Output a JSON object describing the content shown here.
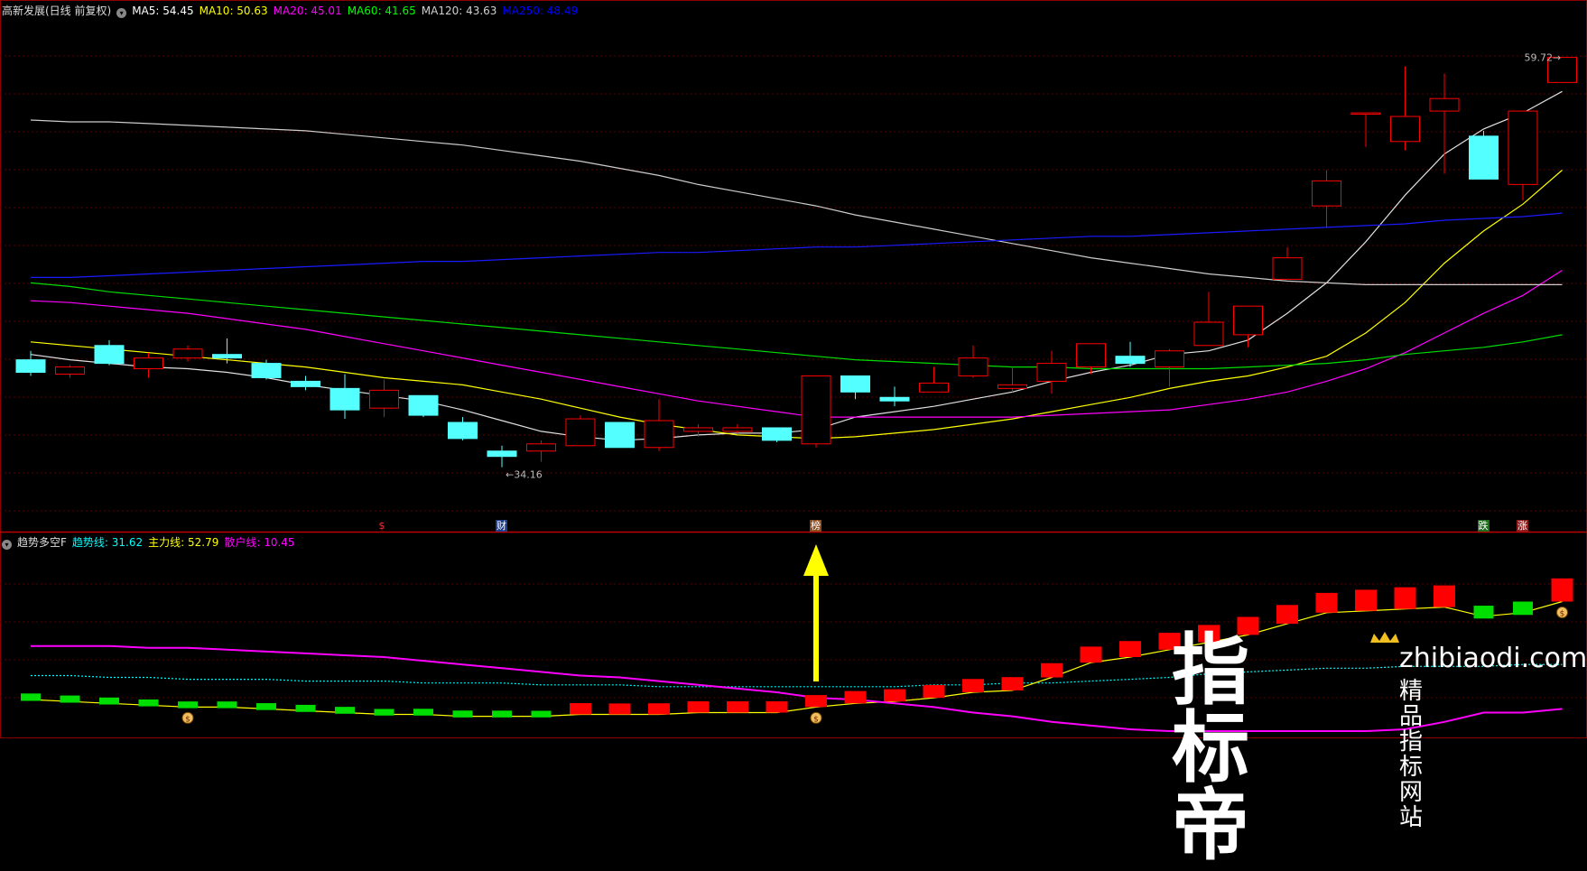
{
  "main_header": {
    "title": "高新发展(日线 前复权)",
    "indicators": [
      {
        "label": "MA5: 54.45",
        "color": "#ffffff"
      },
      {
        "label": "MA10: 50.63",
        "color": "#ffff00"
      },
      {
        "label": "MA20: 45.01",
        "color": "#ff00ff"
      },
      {
        "label": "MA60: 41.65",
        "color": "#00ff00"
      },
      {
        "label": "MA120: 43.63",
        "color": "#d0d0d0"
      },
      {
        "label": "MA250: 48.49",
        "color": "#0000ff"
      }
    ]
  },
  "sub_header": {
    "title": "趋势多空F",
    "indicators": [
      {
        "label": "趋势线: 31.62",
        "color": "#00ffff"
      },
      {
        "label": "主力线: 52.79",
        "color": "#ffff00"
      },
      {
        "label": "散户线: 10.45",
        "color": "#ff00ff"
      }
    ]
  },
  "annotations": {
    "high_label": "59.72",
    "low_label": "34.16",
    "events": [
      {
        "text": "$",
        "index": 9,
        "color": "#ff3333",
        "bg": "transparent"
      },
      {
        "text": "财",
        "index": 12,
        "color": "#ffffff",
        "bg": "#1c3c8c"
      },
      {
        "text": "榜",
        "index": 20,
        "color": "#ffffff",
        "bg": "#8c4a1c"
      },
      {
        "text": "跌",
        "index": 37,
        "color": "#ffffff",
        "bg": "#1c6c1c"
      },
      {
        "text": "涨",
        "index": 38,
        "color": "#ffffff",
        "bg": "#8c1c1c"
      }
    ]
  },
  "watermark": {
    "brand": "指标帝",
    "url": "zhibiaodi.com",
    "tagline": "精品指标网站"
  },
  "chart_data": [
    {
      "type": "candlestick",
      "title": "高新发展(日线 前复权)",
      "ylim": [
        33.5,
        62
      ],
      "up_color": "#ff0000",
      "down_color": "#54ffff",
      "candles": [
        {
          "o": 42.8,
          "h": 43.3,
          "l": 41.9,
          "c": 42.1
        },
        {
          "o": 42.0,
          "h": 42.5,
          "l": 41.8,
          "c": 42.4
        },
        {
          "o": 43.6,
          "h": 43.9,
          "l": 42.5,
          "c": 42.6
        },
        {
          "o": 42.3,
          "h": 43.2,
          "l": 41.8,
          "c": 42.9
        },
        {
          "o": 42.9,
          "h": 43.6,
          "l": 42.7,
          "c": 43.4
        },
        {
          "o": 43.1,
          "h": 44.0,
          "l": 42.6,
          "c": 42.9
        },
        {
          "o": 42.6,
          "h": 42.8,
          "l": 41.7,
          "c": 41.8
        },
        {
          "o": 41.6,
          "h": 41.9,
          "l": 41.1,
          "c": 41.3
        },
        {
          "o": 41.2,
          "h": 42.0,
          "l": 39.5,
          "c": 40.0
        },
        {
          "o": 40.1,
          "h": 41.7,
          "l": 39.6,
          "c": 41.1
        },
        {
          "o": 40.8,
          "h": 40.8,
          "l": 39.6,
          "c": 39.7
        },
        {
          "o": 39.3,
          "h": 39.6,
          "l": 38.3,
          "c": 38.4
        },
        {
          "o": 37.7,
          "h": 38.0,
          "l": 36.8,
          "c": 37.4
        },
        {
          "o": 37.7,
          "h": 38.3,
          "l": 37.1,
          "c": 38.1
        },
        {
          "o": 38.0,
          "h": 39.7,
          "l": 38.0,
          "c": 39.5
        },
        {
          "o": 39.3,
          "h": 39.3,
          "l": 37.9,
          "c": 37.9
        },
        {
          "o": 37.9,
          "h": 40.6,
          "l": 37.7,
          "c": 39.4
        },
        {
          "o": 38.8,
          "h": 39.2,
          "l": 38.5,
          "c": 39.0
        },
        {
          "o": 38.8,
          "h": 39.2,
          "l": 38.7,
          "c": 39.0
        },
        {
          "o": 39.0,
          "h": 39.0,
          "l": 38.2,
          "c": 38.3
        },
        {
          "o": 38.1,
          "h": 41.9,
          "l": 37.9,
          "c": 41.9
        },
        {
          "o": 41.9,
          "h": 41.9,
          "l": 40.6,
          "c": 41.0
        },
        {
          "o": 40.7,
          "h": 41.3,
          "l": 40.2,
          "c": 40.5
        },
        {
          "o": 41.0,
          "h": 42.4,
          "l": 41.0,
          "c": 41.5
        },
        {
          "o": 41.9,
          "h": 43.6,
          "l": 41.8,
          "c": 42.9
        },
        {
          "o": 41.2,
          "h": 42.4,
          "l": 41.0,
          "c": 41.4
        },
        {
          "o": 41.6,
          "h": 43.3,
          "l": 40.9,
          "c": 42.6
        },
        {
          "o": 42.4,
          "h": 43.5,
          "l": 42.0,
          "c": 43.7
        },
        {
          "o": 43.0,
          "h": 43.8,
          "l": 42.4,
          "c": 42.6
        },
        {
          "o": 42.4,
          "h": 43.4,
          "l": 41.3,
          "c": 43.3
        },
        {
          "o": 43.6,
          "h": 46.6,
          "l": 43.6,
          "c": 44.9
        },
        {
          "o": 44.2,
          "h": 45.6,
          "l": 43.5,
          "c": 45.8
        },
        {
          "o": 47.3,
          "h": 49.1,
          "l": 47.3,
          "c": 48.5
        },
        {
          "o": 51.4,
          "h": 53.4,
          "l": 50.2,
          "c": 52.8
        },
        {
          "o": 56.6,
          "h": 56.6,
          "l": 54.7,
          "c": 56.6
        },
        {
          "o": 55.0,
          "h": 59.2,
          "l": 54.5,
          "c": 56.4
        },
        {
          "o": 56.7,
          "h": 58.8,
          "l": 53.2,
          "c": 57.4
        },
        {
          "o": 55.3,
          "h": 55.6,
          "l": 52.9,
          "c": 52.9
        },
        {
          "o": 52.6,
          "h": 56.7,
          "l": 51.7,
          "c": 56.7
        },
        {
          "o": 58.3,
          "h": 59.7,
          "l": 58.3,
          "c": 59.7
        }
      ],
      "series": [
        {
          "name": "MA5",
          "color": "#e0e0e0",
          "values": [
            43.1,
            42.8,
            42.6,
            42.4,
            42.3,
            42.1,
            41.8,
            41.4,
            41.1,
            40.8,
            40.5,
            40.0,
            39.4,
            38.8,
            38.5,
            38.3,
            38.4,
            38.6,
            38.7,
            38.7,
            38.9,
            39.6,
            39.9,
            40.2,
            40.6,
            41.0,
            41.6,
            42.1,
            42.5,
            43.1,
            43.3,
            43.9,
            45.4,
            47.1,
            49.4,
            52.0,
            54.3,
            55.7,
            56.6,
            57.8
          ]
        },
        {
          "name": "MA10",
          "color": "#ffff00",
          "values": [
            43.8,
            43.6,
            43.4,
            43.2,
            43.0,
            42.8,
            42.6,
            42.4,
            42.1,
            41.8,
            41.6,
            41.4,
            41.0,
            40.6,
            40.1,
            39.6,
            39.2,
            38.9,
            38.6,
            38.5,
            38.4,
            38.5,
            38.7,
            38.9,
            39.2,
            39.5,
            39.9,
            40.3,
            40.7,
            41.2,
            41.6,
            41.9,
            42.4,
            43.0,
            44.3,
            46.0,
            48.2,
            50.0,
            51.5,
            53.4
          ]
        },
        {
          "name": "MA20",
          "color": "#ff00ff",
          "values": [
            46.1,
            46.0,
            45.8,
            45.6,
            45.4,
            45.1,
            44.8,
            44.5,
            44.1,
            43.7,
            43.3,
            42.9,
            42.5,
            42.1,
            41.7,
            41.3,
            40.9,
            40.5,
            40.2,
            39.9,
            39.6,
            39.6,
            39.6,
            39.6,
            39.6,
            39.6,
            39.7,
            39.8,
            39.9,
            40.0,
            40.3,
            40.6,
            41.0,
            41.6,
            42.3,
            43.2,
            44.3,
            45.4,
            46.4,
            47.8
          ]
        },
        {
          "name": "MA60",
          "color": "#00dd00",
          "values": [
            47.1,
            46.9,
            46.6,
            46.4,
            46.2,
            46.0,
            45.8,
            45.6,
            45.4,
            45.2,
            45.0,
            44.8,
            44.6,
            44.4,
            44.2,
            44.0,
            43.8,
            43.6,
            43.4,
            43.2,
            43.0,
            42.8,
            42.7,
            42.6,
            42.5,
            42.4,
            42.4,
            42.3,
            42.3,
            42.3,
            42.3,
            42.4,
            42.5,
            42.6,
            42.8,
            43.1,
            43.3,
            43.5,
            43.8,
            44.2
          ]
        },
        {
          "name": "MA120",
          "color": "#cccccc",
          "values": [
            56.2,
            56.1,
            56.1,
            56.0,
            55.9,
            55.8,
            55.7,
            55.6,
            55.4,
            55.2,
            55.0,
            54.8,
            54.5,
            54.2,
            53.9,
            53.5,
            53.1,
            52.6,
            52.2,
            51.8,
            51.4,
            50.9,
            50.5,
            50.1,
            49.7,
            49.3,
            48.9,
            48.5,
            48.2,
            47.9,
            47.6,
            47.4,
            47.2,
            47.1,
            47.0,
            47.0,
            47.0,
            47.0,
            47.0,
            47.0
          ]
        },
        {
          "name": "MA250",
          "color": "#1a1aff",
          "values": [
            47.4,
            47.4,
            47.5,
            47.6,
            47.7,
            47.8,
            47.9,
            48.0,
            48.1,
            48.2,
            48.3,
            48.3,
            48.4,
            48.5,
            48.6,
            48.7,
            48.8,
            48.8,
            48.9,
            49.0,
            49.1,
            49.1,
            49.2,
            49.3,
            49.4,
            49.5,
            49.6,
            49.7,
            49.7,
            49.8,
            49.9,
            50.0,
            50.1,
            50.2,
            50.3,
            50.4,
            50.6,
            50.7,
            50.8,
            51.0
          ]
        }
      ]
    },
    {
      "type": "bar",
      "title": "趋势多空F",
      "ylim": [
        0,
        100
      ],
      "bars": [
        {
          "value": -9,
          "dir": "down"
        },
        {
          "value": -7,
          "dir": "down"
        },
        {
          "value": -5,
          "dir": "down"
        },
        {
          "value": -4,
          "dir": "down"
        },
        {
          "value": -2,
          "dir": "down"
        },
        {
          "value": -2,
          "dir": "down"
        },
        {
          "value": -4,
          "dir": "down"
        },
        {
          "value": -6,
          "dir": "down"
        },
        {
          "value": -4,
          "dir": "down"
        },
        {
          "value": -1,
          "dir": "down"
        },
        {
          "value": -3,
          "dir": "down"
        },
        {
          "value": -4,
          "dir": "down"
        },
        {
          "value": -3,
          "dir": "down"
        },
        {
          "value": -1,
          "dir": "down"
        },
        {
          "value": 3,
          "dir": "up"
        },
        {
          "value": 1,
          "dir": "up"
        },
        {
          "value": 2,
          "dir": "up"
        },
        {
          "value": 3,
          "dir": "up"
        },
        {
          "value": 3,
          "dir": "up"
        },
        {
          "value": 3,
          "dir": "up"
        },
        {
          "value": 7,
          "dir": "up"
        },
        {
          "value": 9,
          "dir": "up"
        },
        {
          "value": 9,
          "dir": "up"
        },
        {
          "value": 12,
          "dir": "up"
        },
        {
          "value": 15,
          "dir": "up"
        },
        {
          "value": 15,
          "dir": "up"
        },
        {
          "value": 21,
          "dir": "up"
        },
        {
          "value": 32,
          "dir": "up"
        },
        {
          "value": 32,
          "dir": "up"
        },
        {
          "value": 37,
          "dir": "up"
        },
        {
          "value": 40,
          "dir": "up"
        },
        {
          "value": 44,
          "dir": "up"
        },
        {
          "value": 49,
          "dir": "up"
        },
        {
          "value": 55,
          "dir": "up"
        },
        {
          "value": 63,
          "dir": "up"
        },
        {
          "value": 67,
          "dir": "up"
        },
        {
          "value": 67,
          "dir": "up"
        },
        {
          "value": -65,
          "dir": "down"
        },
        {
          "value": -70,
          "dir": "down"
        },
        {
          "value": 76,
          "dir": "up"
        }
      ],
      "series": [
        {
          "name": "趋势线",
          "color": "#00ffff",
          "values": [
            30,
            30,
            29,
            29,
            28,
            28,
            28,
            27,
            27,
            27,
            26,
            26,
            26,
            25,
            25,
            25,
            24,
            24,
            24,
            24,
            24,
            24,
            24,
            25,
            25,
            26,
            26,
            27,
            28,
            29,
            31,
            32,
            33,
            34,
            34,
            35,
            35,
            35,
            36,
            36
          ]
        },
        {
          "name": "主力线",
          "color": "#ffff00",
          "values": [
            17,
            16,
            15,
            14,
            13,
            13,
            12,
            11,
            10,
            9,
            9,
            8,
            8,
            8,
            9,
            9,
            9,
            10,
            10,
            10,
            13,
            15,
            16,
            18,
            21,
            22,
            29,
            37,
            40,
            44,
            48,
            52,
            58,
            64,
            65,
            66,
            67,
            62,
            64,
            70
          ]
        },
        {
          "name": "散户线",
          "color": "#ff00ff",
          "values": [
            46,
            46,
            46,
            45,
            45,
            44,
            43,
            42,
            41,
            40,
            38,
            36,
            34,
            32,
            30,
            29,
            27,
            25,
            23,
            21,
            18,
            17,
            15,
            13,
            10,
            8,
            5,
            3,
            1,
            0,
            0,
            0,
            0,
            0,
            0,
            1,
            5,
            10,
            10,
            12
          ]
        }
      ],
      "signals": [
        {
          "index": 4,
          "type": "$"
        },
        {
          "index": 20,
          "type": "$"
        },
        {
          "index": 39,
          "type": "$"
        }
      ]
    }
  ]
}
